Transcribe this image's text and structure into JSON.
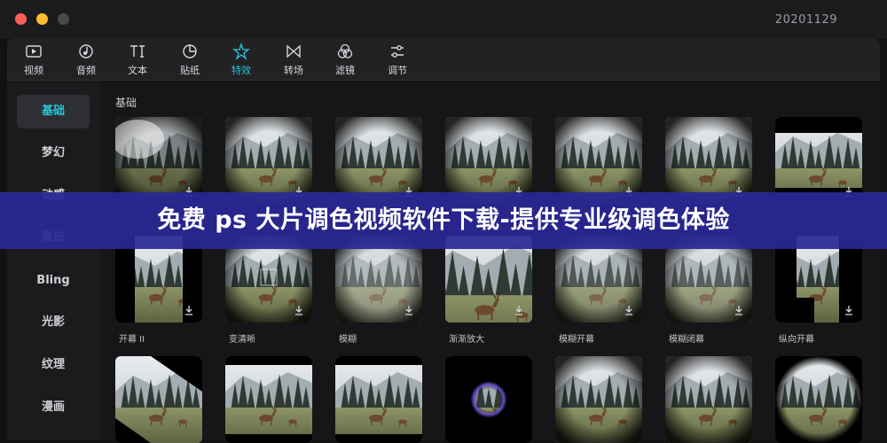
{
  "window": {
    "title": "20201129"
  },
  "toolbar": {
    "items": [
      {
        "label": "视频",
        "icon": "video-icon"
      },
      {
        "label": "音频",
        "icon": "audio-icon"
      },
      {
        "label": "文本",
        "icon": "text-icon"
      },
      {
        "label": "贴纸",
        "icon": "sticker-icon"
      },
      {
        "label": "特效",
        "icon": "effects-icon",
        "active": true
      },
      {
        "label": "转场",
        "icon": "transition-icon"
      },
      {
        "label": "滤镜",
        "icon": "filter-icon"
      },
      {
        "label": "调节",
        "icon": "adjust-icon"
      }
    ],
    "active_color": "#27c6d4"
  },
  "sidebar": {
    "items": [
      {
        "label": "基础",
        "active": true
      },
      {
        "label": "梦幻"
      },
      {
        "label": "动感"
      },
      {
        "label": "复古"
      },
      {
        "label": "Bling"
      },
      {
        "label": "光影"
      },
      {
        "label": "纹理"
      },
      {
        "label": "漫画"
      }
    ]
  },
  "section": {
    "title": "基础"
  },
  "effects": {
    "row1": [
      "",
      "",
      "",
      "",
      "",
      "",
      ""
    ],
    "row2": [
      "开幕 II",
      "变清晰",
      "模糊",
      "渐渐放大",
      "模糊开幕",
      "模糊闭幕",
      "纵向开幕"
    ],
    "row3": [
      "",
      "",
      "",
      "",
      "",
      "",
      ""
    ]
  },
  "banner": {
    "text": "免费 ps 大片调色视频软件下载-提供专业级调色体验",
    "color": "#2a2896"
  }
}
